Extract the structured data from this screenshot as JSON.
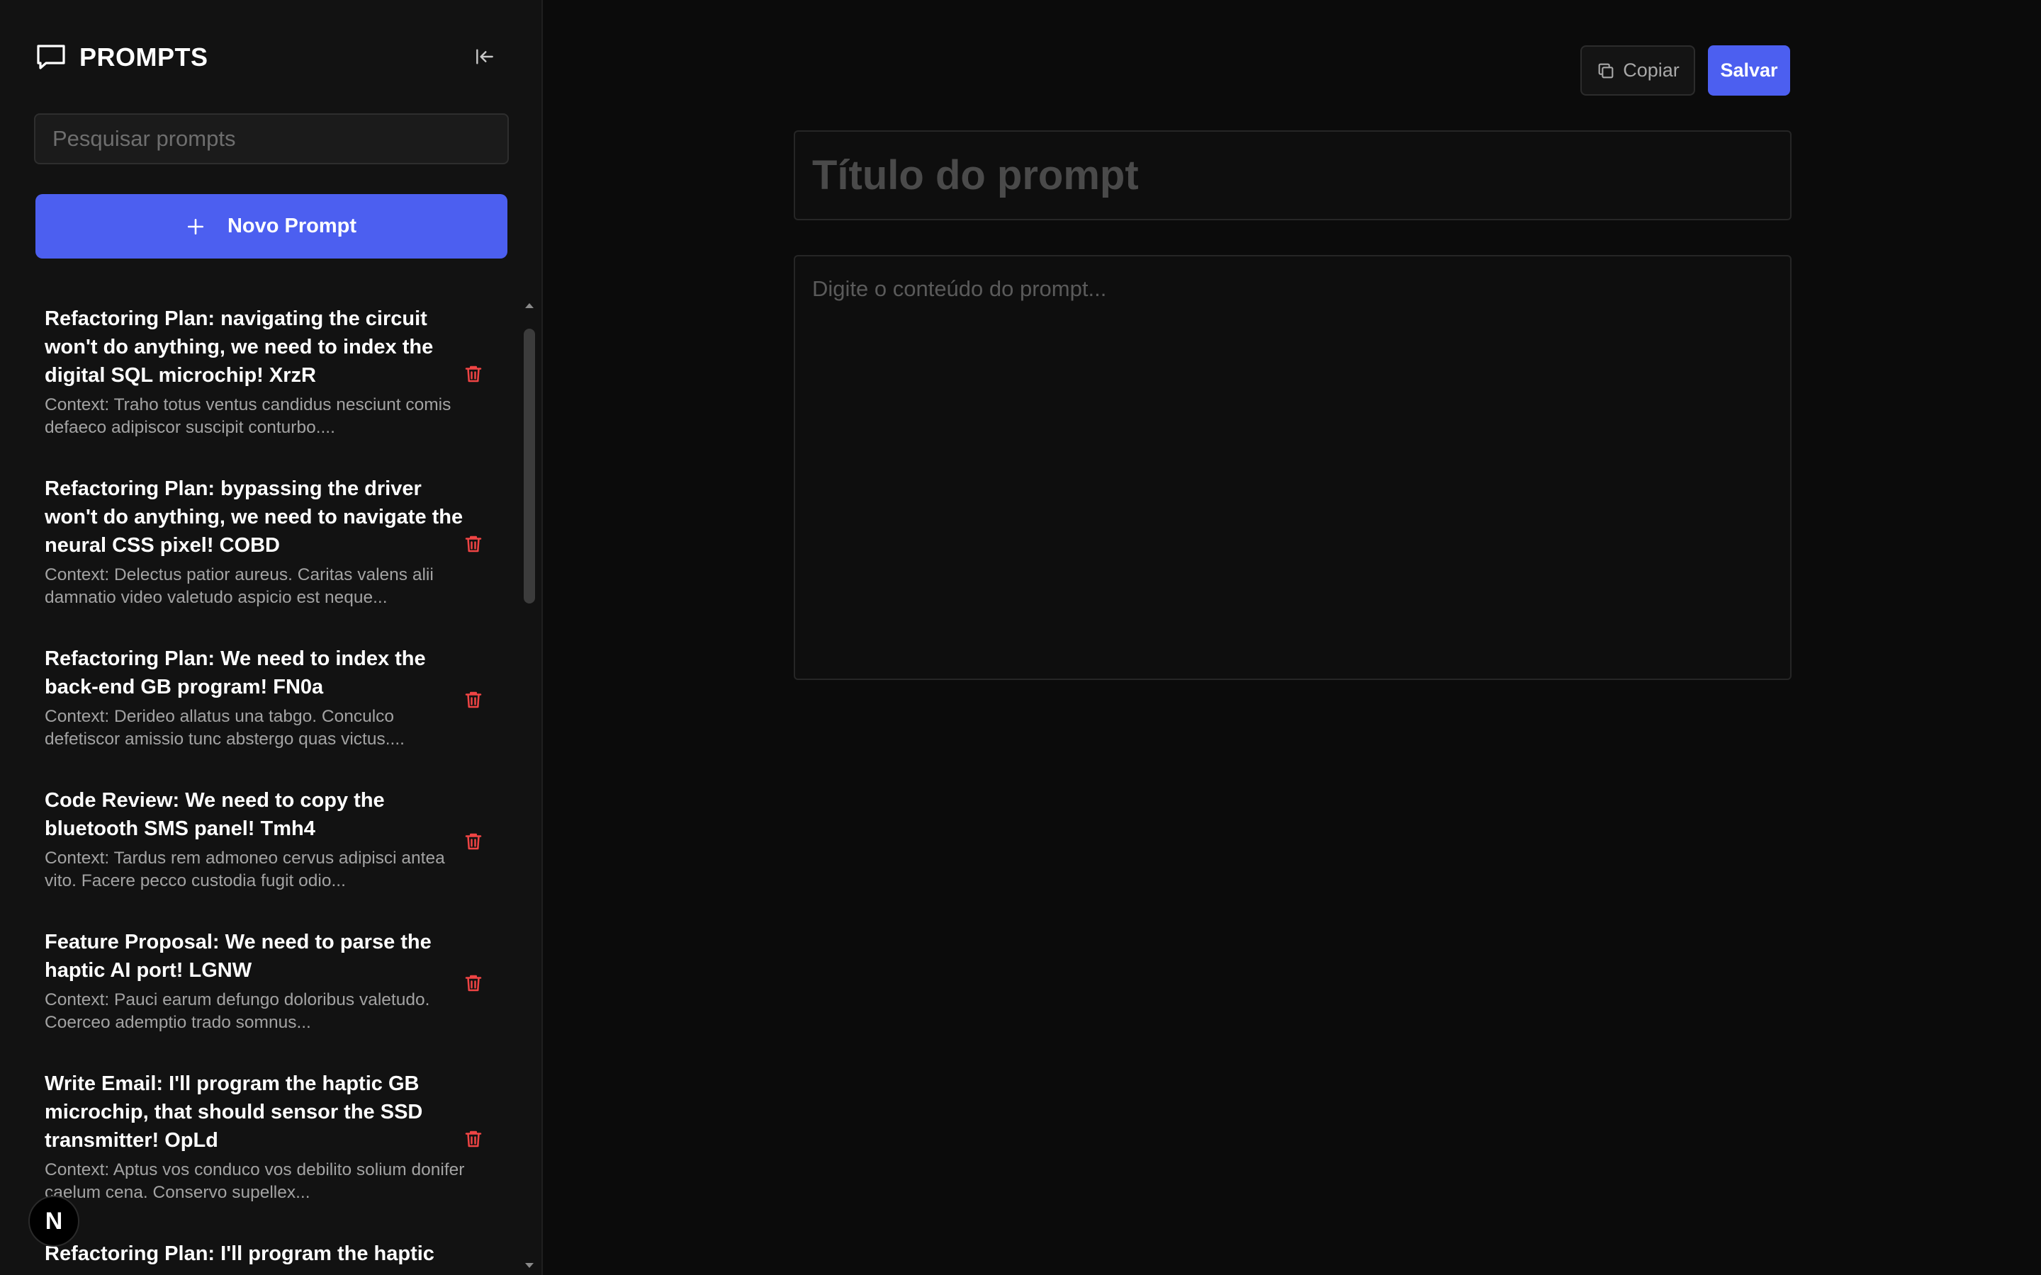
{
  "app": {
    "title": "PROMPTS"
  },
  "sidebar": {
    "search_placeholder": "Pesquisar prompts",
    "new_prompt_label": "Novo Prompt",
    "prompts": [
      {
        "title": "Refactoring Plan: navigating the circuit won't do anything, we need to index the digital SQL microchip! XrzR",
        "description": "Context: Traho totus ventus candidus nesciunt comis defaeco adipiscor suscipit conturbo...."
      },
      {
        "title": "Refactoring Plan: bypassing the driver won't do anything, we need to navigate the neural CSS pixel! COBD",
        "description": "Context: Delectus patior aureus. Caritas valens alii damnatio video valetudo aspicio est neque..."
      },
      {
        "title": "Refactoring Plan: We need to index the back-end GB program! FN0a",
        "description": "Context: Derideo allatus una tabgo. Conculco defetiscor amissio tunc abstergo quas victus...."
      },
      {
        "title": "Code Review: We need to copy the bluetooth SMS panel! Tmh4",
        "description": "Context: Tardus rem admoneo cervus adipisci antea vito. Facere pecco custodia fugit odio..."
      },
      {
        "title": "Feature Proposal: We need to parse the haptic AI port! LGNW",
        "description": "Context: Pauci earum defungo doloribus valetudo. Coerceo ademptio trado somnus..."
      },
      {
        "title": "Write Email: I'll program the haptic GB microchip, that should sensor the SSD transmitter! OpLd",
        "description": "Context: Aptus vos conduco vos debilito solium donifer caelum cena. Conservo supellex..."
      },
      {
        "title": "Refactoring Plan: I'll program the haptic",
        "description": ""
      }
    ],
    "badge_letter": "N"
  },
  "editor": {
    "copy_label": "Copiar",
    "save_label": "Salvar",
    "title_placeholder": "Título do prompt",
    "content_placeholder": "Digite o conteúdo do prompt..."
  },
  "colors": {
    "accent": "#4c5ff0",
    "danger": "#ef4444",
    "background": "#0b0b0b",
    "sidebar": "#121212"
  },
  "icons": {
    "brand": "chat-bubble-icon",
    "collapse": "collapse-left-icon",
    "new": "plus-icon",
    "delete": "trash-icon",
    "copy": "copy-icon"
  }
}
